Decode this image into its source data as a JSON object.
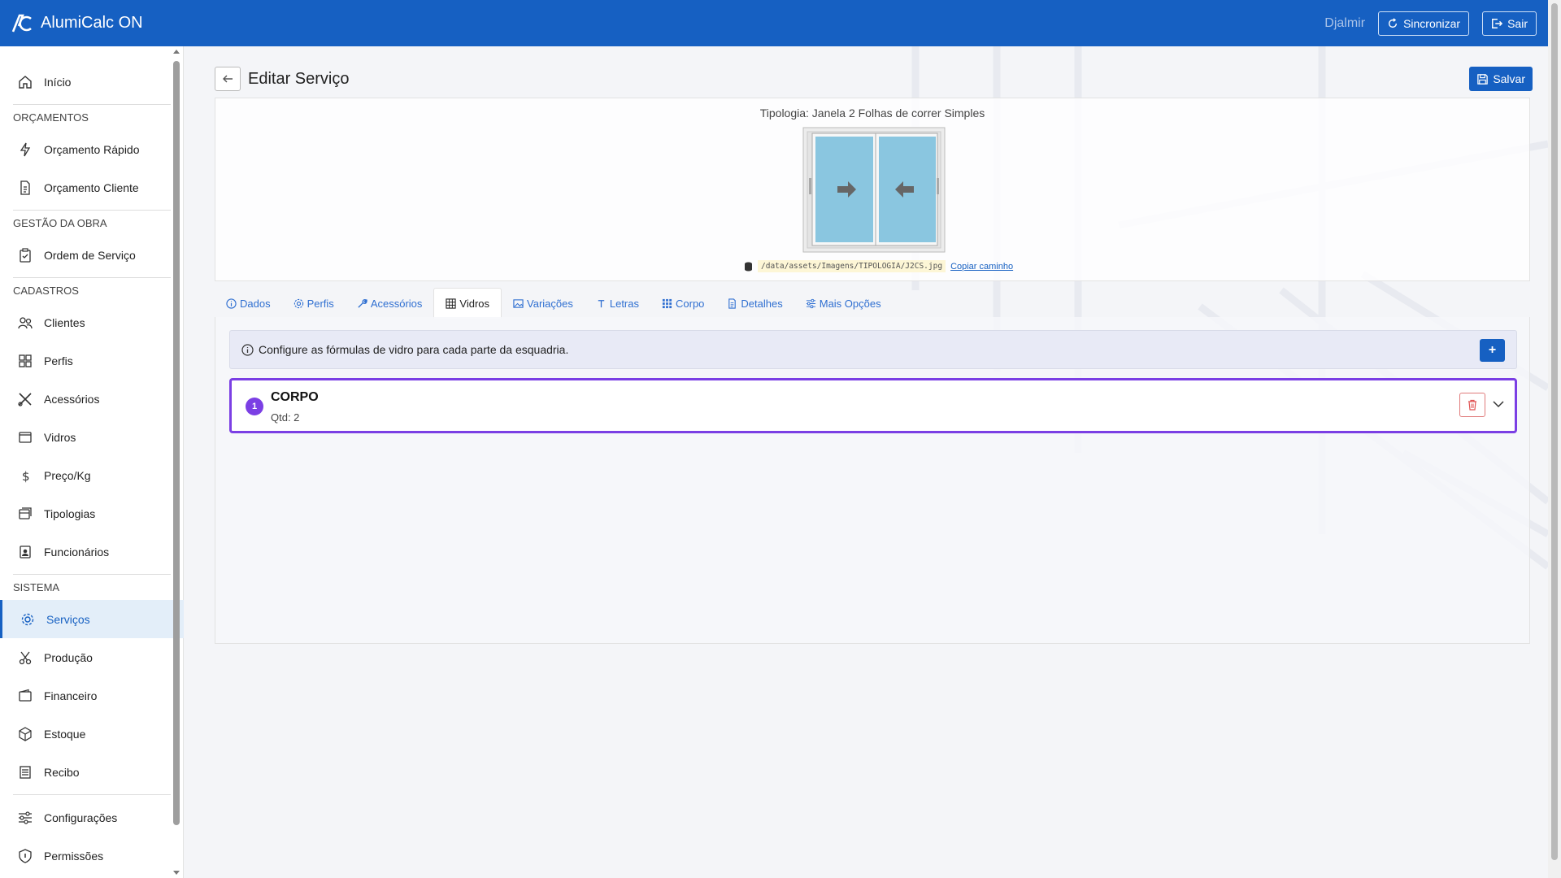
{
  "app": {
    "title": "AlumiCalc ON"
  },
  "header": {
    "user": "Djalmir",
    "sync_label": "Sincronizar",
    "logout_label": "Sair"
  },
  "sidebar": {
    "home": "Início",
    "sections": {
      "orcamentos": "ORÇAMENTOS",
      "gestao": "GESTÃO DA OBRA",
      "cadastros": "CADASTROS",
      "sistema": "SISTEMA"
    },
    "items": {
      "orcamento_rapido": "Orçamento Rápido",
      "orcamento_cliente": "Orçamento Cliente",
      "ordem_servico": "Ordem de Serviço",
      "clientes": "Clientes",
      "perfis": "Perfis",
      "acessorios": "Acessórios",
      "vidros": "Vidros",
      "preco_kg": "Preço/Kg",
      "tipologias": "Tipologias",
      "funcionarios": "Funcionários",
      "servicos": "Serviços",
      "producao": "Produção",
      "financeiro": "Financeiro",
      "estoque": "Estoque",
      "recibo": "Recibo",
      "configuracoes": "Configurações",
      "permissoes": "Permissões"
    },
    "active": "servicos"
  },
  "page": {
    "title": "Editar Serviço",
    "save_label": "Salvar",
    "tipologia": "Tipologia: Janela 2 Folhas de correr Simples",
    "image_path": "/data/assets/Imagens/TIPOLOGIA/J2CS.jpg",
    "copy_path_label": "Copiar caminho"
  },
  "tabs": [
    {
      "label": "Dados",
      "icon": "info-icon"
    },
    {
      "label": "Perfis",
      "icon": "gear-icon"
    },
    {
      "label": "Acessórios",
      "icon": "wrench-icon"
    },
    {
      "label": "Vidros",
      "icon": "grid-icon",
      "active": true
    },
    {
      "label": "Variações",
      "icon": "image-icon"
    },
    {
      "label": "Letras",
      "icon": "text-icon"
    },
    {
      "label": "Corpo",
      "icon": "dots-grid-icon"
    },
    {
      "label": "Detalhes",
      "icon": "document-icon"
    },
    {
      "label": "Mais Opções",
      "icon": "sliders-icon"
    }
  ],
  "vidros": {
    "info_text": "Configure as fórmulas de vidro para cada parte da esquadria.",
    "add_label": "+",
    "items": [
      {
        "index": "1",
        "title": "CORPO",
        "qty": "Qtd: 2"
      }
    ]
  },
  "colors": {
    "primary": "#1660c2",
    "accent": "#7b3fe4",
    "danger": "#e05252"
  }
}
